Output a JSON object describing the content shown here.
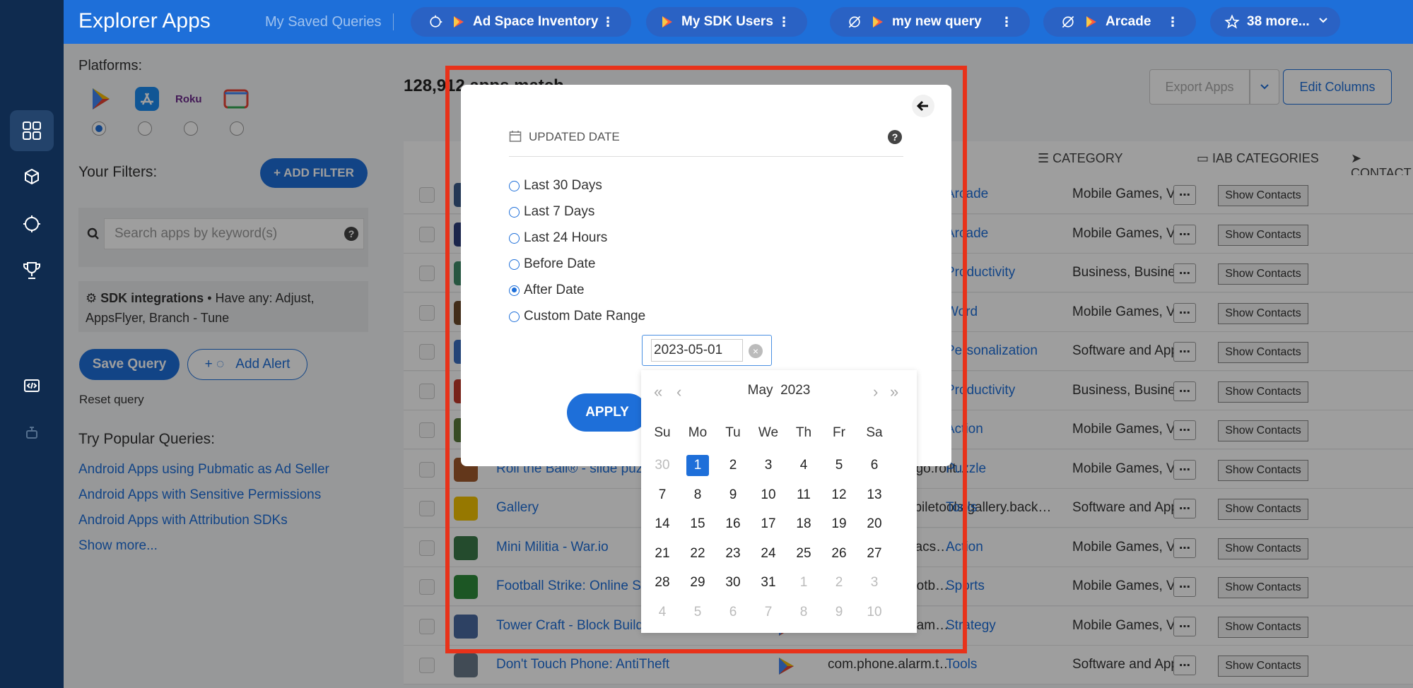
{
  "app": {
    "brand": "Explorer Apps"
  },
  "topbar": {
    "saved_label": "My Saved Queries",
    "queries": [
      {
        "label": "Ad Space Inventory",
        "icon": "sdk-icon",
        "more": "⋮"
      },
      {
        "label": "My SDK Users",
        "icon": "none",
        "more": "⋮"
      },
      {
        "label": "my new query",
        "icon": "sdk-crossed-icon",
        "more": "⋮"
      },
      {
        "label": "Arcade",
        "icon": "sdk-crossed-icon",
        "more": "⋮"
      }
    ],
    "more_queries": "38 more..."
  },
  "sidebar": {
    "platforms_label": "Platforms:",
    "platforms": [
      "google-play-icon",
      "app-store-icon",
      "roku-icon",
      "google-tv-icon"
    ],
    "roku_text": "Roku",
    "selected_platform": 0,
    "filters_label": "Your Filters:",
    "add_filter": "+ ADD FILTER",
    "search_placeholder": "Search apps by keyword(s)",
    "help": "?",
    "sdk_title": "SDK integrations",
    "sdk_detail": "Have any: Adjust, AppsFlyer, Branch - Tune",
    "save_query": "Save Query",
    "add_alert": "Add Alert",
    "reset_query": "Reset query",
    "popular_label": "Try Popular Queries:",
    "popular": [
      "Android Apps using Pubmatic as Ad Seller",
      "Android Apps with Sensitive Permissions",
      "Android Apps with Attribution SDKs"
    ],
    "show_more": "Show more..."
  },
  "main": {
    "results_title": "128,912 apps match",
    "export": "Export Apps",
    "edit_columns": "Edit Columns",
    "headers": {
      "category": "CATEGORY",
      "iab": "IAB CATEGORIES",
      "contact": "CONTACT"
    },
    "rows": [
      {
        "name": "",
        "pkg": "",
        "category": "Arcade",
        "iab": "Mobile Games, Vi",
        "thumb": "#3b5b8a"
      },
      {
        "name": "",
        "pkg": "",
        "category": "Arcade",
        "iab": "Mobile Games, Vi",
        "thumb": "#2c3d7a"
      },
      {
        "name": "",
        "pkg": "",
        "category": "Productivity",
        "iab": "Business, Busine",
        "thumb": "#3f8c6a"
      },
      {
        "name": "",
        "pkg": "",
        "category": "Word",
        "iab": "Mobile Games, Vi",
        "thumb": "#6b4a2a"
      },
      {
        "name": "",
        "pkg": "",
        "category": "Personalization",
        "iab": "Software and App",
        "thumb": "#3a6fc0"
      },
      {
        "name": "",
        "pkg": "",
        "category": "Productivity",
        "iab": "Business, Busine",
        "thumb": "#c0392b"
      },
      {
        "name": "",
        "pkg": "",
        "category": "Action",
        "iab": "Mobile Games, Vi",
        "thumb": "#5a7a3a"
      },
      {
        "name": "Roll the Ball® - slide puzzle",
        "pkg": "com.bitmango.go.rollt…",
        "category": "Puzzle",
        "iab": "Mobile Games, Vi",
        "thumb": "#a05a2c"
      },
      {
        "name": "Gallery",
        "pkg": "com.simplemobiletools.gallery.back…",
        "category": "Tools",
        "iab": "Software and App",
        "thumb": "#f2c200"
      },
      {
        "name": "Mini Militia - War.io",
        "pkg": "com.appsomniacs…",
        "category": "Action",
        "iab": "Mobile Games, Vi",
        "thumb": "#3a7a4a"
      },
      {
        "name": "Football Strike: Online Soccer",
        "pkg": "com.miniclip.footb…",
        "category": "Sports",
        "iab": "Mobile Games, Vi",
        "thumb": "#2e8b3a"
      },
      {
        "name": "Tower Craft - Block Building",
        "pkg": "com.quantumgam…",
        "category": "Strategy",
        "iab": "Mobile Games, Vi",
        "thumb": "#4a6aa0"
      },
      {
        "name": "Don't Touch Phone: AntiTheft",
        "pkg": "com.phone.alarm.t…",
        "category": "Tools",
        "iab": "Software and App",
        "thumb": "#6a7a8a"
      }
    ],
    "dots": "⋯",
    "show_contacts": "Show Contacts"
  },
  "modal": {
    "title": "UPDATED DATE",
    "help": "?",
    "options": [
      "Last 30 Days",
      "Last 7 Days",
      "Last 24 Hours",
      "Before Date",
      "After Date",
      "Custom Date Range"
    ],
    "selected_option": 4,
    "date_value": "2023-05-01",
    "clear": "×",
    "apply": "APPLY"
  },
  "calendar": {
    "month": "May",
    "year": "2023",
    "nav": {
      "prev_year": "«",
      "prev_month": "‹",
      "next_month": "›",
      "next_year": "»"
    },
    "weekdays": [
      "Su",
      "Mo",
      "Tu",
      "We",
      "Th",
      "Fr",
      "Sa"
    ],
    "weeks": [
      [
        "30",
        "1",
        "2",
        "3",
        "4",
        "5",
        "6"
      ],
      [
        "7",
        "8",
        "9",
        "10",
        "11",
        "12",
        "13"
      ],
      [
        "14",
        "15",
        "16",
        "17",
        "18",
        "19",
        "20"
      ],
      [
        "21",
        "22",
        "23",
        "24",
        "25",
        "26",
        "27"
      ],
      [
        "28",
        "29",
        "30",
        "31",
        "1",
        "2",
        "3"
      ],
      [
        "4",
        "5",
        "6",
        "7",
        "8",
        "9",
        "10"
      ]
    ],
    "selected_day": "1"
  },
  "colors": {
    "brand": "#1e6fd9",
    "rail": "#0f2b4f",
    "highlight": "#e8321a"
  }
}
